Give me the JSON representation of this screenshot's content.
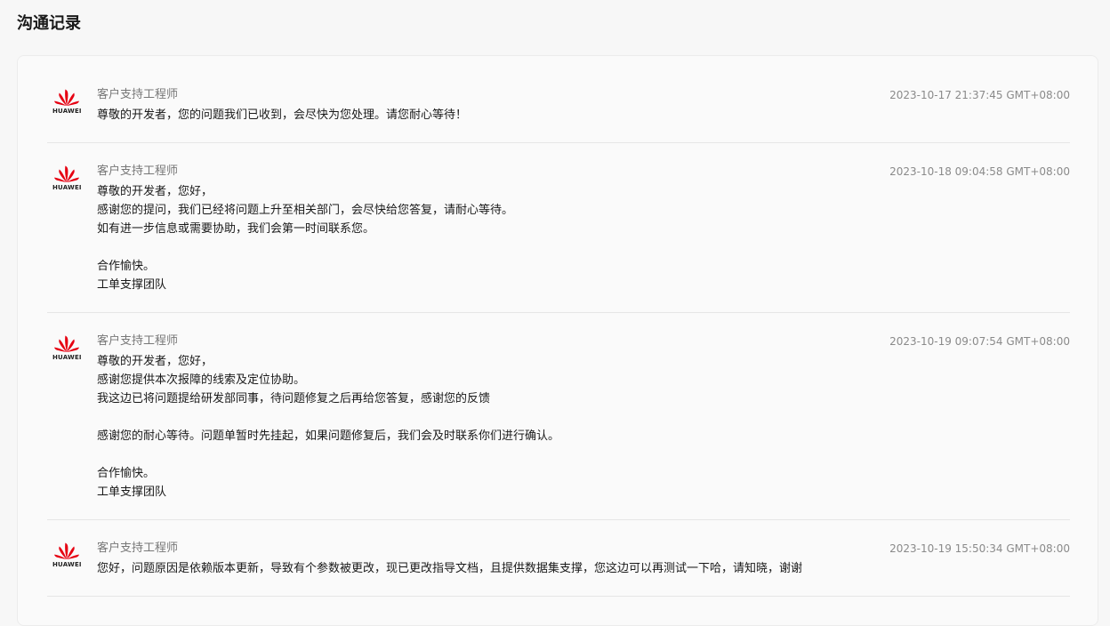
{
  "page": {
    "title": "沟通记录"
  },
  "brand": {
    "logo_text": "HUAWEI",
    "logo_color": "#e60012"
  },
  "records": [
    {
      "author": "客户支持工程师",
      "timestamp": "2023-10-17 21:37:45 GMT+08:00",
      "lines": [
        "尊敬的开发者，您的问题我们已收到，会尽快为您处理。请您耐心等待！"
      ]
    },
    {
      "author": "客户支持工程师",
      "timestamp": "2023-10-18 09:04:58 GMT+08:00",
      "lines": [
        "尊敬的开发者，您好，",
        "感谢您的提问，我们已经将问题上升至相关部门，会尽快给您答复，请耐心等待。",
        "如有进一步信息或需要协助，我们会第一时间联系您。",
        "",
        "合作愉快。",
        "工单支撑团队"
      ]
    },
    {
      "author": "客户支持工程师",
      "timestamp": "2023-10-19 09:07:54 GMT+08:00",
      "lines": [
        "尊敬的开发者，您好，",
        "感谢您提供本次报障的线索及定位协助。",
        "我这边已将问题提给研发部同事，待问题修复之后再给您答复，感谢您的反馈",
        "",
        "感谢您的耐心等待。问题单暂时先挂起，如果问题修复后，我们会及时联系你们进行确认。",
        "",
        "合作愉快。",
        "工单支撑团队"
      ]
    },
    {
      "author": "客户支持工程师",
      "timestamp": "2023-10-19 15:50:34 GMT+08:00",
      "lines": [
        "您好，问题原因是依赖版本更新，导致有个参数被更改，现已更改指导文档，且提供数据集支撑，您这边可以再测试一下哈，请知晓，谢谢"
      ]
    }
  ]
}
